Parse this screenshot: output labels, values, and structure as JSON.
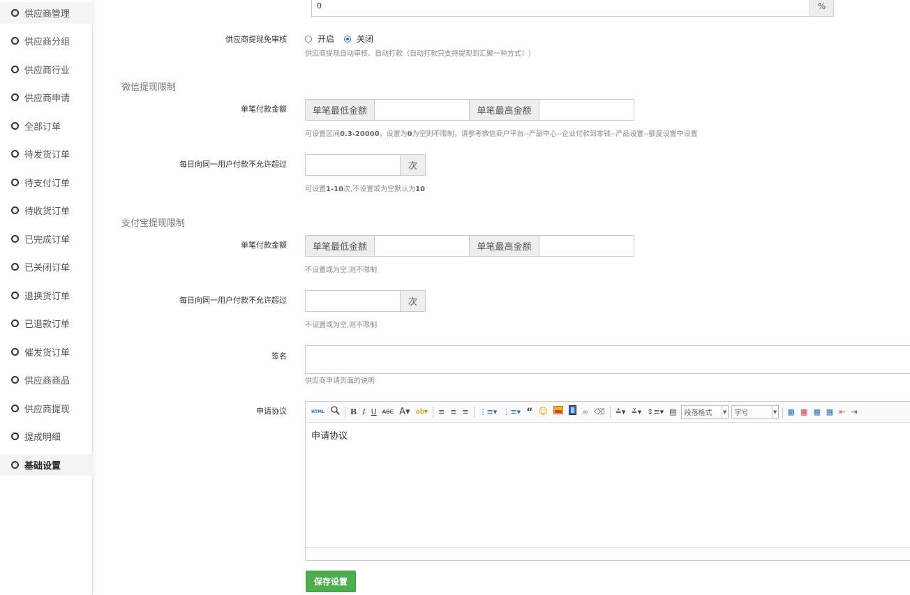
{
  "sidebar": {
    "items": [
      {
        "label": "供应商管理"
      },
      {
        "label": "供应商分组"
      },
      {
        "label": "供应商行业"
      },
      {
        "label": "供应商申请"
      },
      {
        "label": "全部订单"
      },
      {
        "label": "待发货订单"
      },
      {
        "label": "待支付订单"
      },
      {
        "label": "待收货订单"
      },
      {
        "label": "已完成订单"
      },
      {
        "label": "已关闭订单"
      },
      {
        "label": "退换货订单"
      },
      {
        "label": "已退款订单"
      },
      {
        "label": "催发货订单"
      },
      {
        "label": "供应商商品"
      },
      {
        "label": "供应商提现"
      },
      {
        "label": "提成明细"
      },
      {
        "label": "基础设置"
      }
    ],
    "active_index": 16
  },
  "top_input": {
    "value": "0",
    "suffix": "%"
  },
  "withdraw_review": {
    "label": "供应商提现免审核",
    "option_on": "开启",
    "option_off": "关闭",
    "selected": "关闭",
    "help": "供应商提现自动审核、自动打款（自动打款只支持提现到汇聚一种方式！）"
  },
  "wechat": {
    "section_title": "微信提现限制",
    "amount_label": "单笔付款金额",
    "min_addon": "单笔最低金额",
    "max_addon": "单笔最高金额",
    "min_value": "",
    "max_value": "",
    "amount_help_pre": "可设置区间",
    "amount_help_range": "0.3-20000",
    "amount_help_mid": "，设置为",
    "amount_help_zero": "0",
    "amount_help_post": "为空则不限制，请参考微信商户平台--产品中心--企业付款到零钱--产品设置--额度设置中设置",
    "daily_label": "每日向同一用户付款不允许超过",
    "daily_value": "",
    "daily_suffix": "次",
    "daily_help_pre": "可设置",
    "daily_help_range": "1-10",
    "daily_help_mid": "次,不设置或为空默认为",
    "daily_help_default": "10"
  },
  "alipay": {
    "section_title": "支付宝提现限制",
    "amount_label": "单笔付款金额",
    "min_addon": "单笔最低金额",
    "max_addon": "单笔最高金额",
    "min_value": "",
    "max_value": "",
    "amount_help": "不设置或为空,则不限制",
    "daily_label": "每日向同一用户付款不允许超过",
    "daily_value": "",
    "daily_suffix": "次",
    "daily_help": "不设置或为空,则不限制"
  },
  "signature": {
    "label": "签名",
    "value": "",
    "help": "供应商申请页面的说明"
  },
  "agreement": {
    "label": "申请协议",
    "content": "申请协议",
    "toolbar": {
      "html": "HTML",
      "para_format": "段落格式",
      "font_size": "字号"
    }
  },
  "save_button": "保存设置"
}
